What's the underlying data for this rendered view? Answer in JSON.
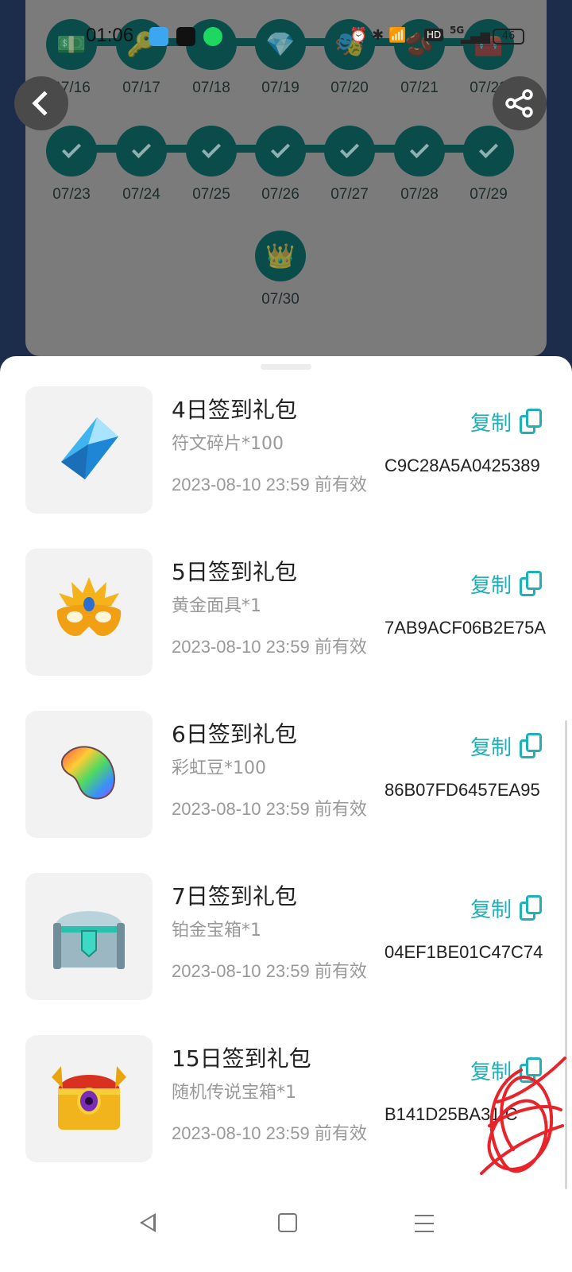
{
  "status_bar": {
    "time": "01:06",
    "network": "5G",
    "hd_badge": "HD",
    "battery": "46"
  },
  "calendar": {
    "rows": [
      [
        {
          "date": "07/16",
          "reward_icon": "cash-icon",
          "glyph": "💵",
          "checked": false
        },
        {
          "date": "07/17",
          "reward_icon": "key-icon",
          "glyph": "🔑",
          "checked": false
        },
        {
          "date": "07/18",
          "reward_icon": "blank",
          "glyph": "",
          "checked": false
        },
        {
          "date": "07/19",
          "reward_icon": "crystal-icon",
          "glyph": "💎",
          "checked": false
        },
        {
          "date": "07/20",
          "reward_icon": "mask-icon",
          "glyph": "🎭",
          "checked": false
        },
        {
          "date": "07/21",
          "reward_icon": "rainbow-bean-icon",
          "glyph": "🫘",
          "checked": false
        },
        {
          "date": "07/22",
          "reward_icon": "chest-icon",
          "glyph": "🧰",
          "checked": false
        }
      ],
      [
        {
          "date": "07/23",
          "checked": true
        },
        {
          "date": "07/24",
          "checked": true
        },
        {
          "date": "07/25",
          "checked": true
        },
        {
          "date": "07/26",
          "checked": true
        },
        {
          "date": "07/27",
          "checked": true
        },
        {
          "date": "07/28",
          "checked": true
        },
        {
          "date": "07/29",
          "checked": true
        }
      ],
      [
        {
          "date": "07/30",
          "reward_icon": "treasure-chest-icon",
          "glyph": "👑",
          "checked": false
        }
      ]
    ]
  },
  "gifts": [
    {
      "title": "4日签到礼包",
      "item": "符文碎片*100",
      "expiry": "2023-08-10 23:59 前有效",
      "copy_label": "复制",
      "code": "C9C28A5A0425389",
      "icon": "rune-crystal-icon"
    },
    {
      "title": "5日签到礼包",
      "item": "黄金面具*1",
      "expiry": "2023-08-10 23:59 前有效",
      "copy_label": "复制",
      "code": "7AB9ACF06B2E75A",
      "icon": "golden-mask-icon"
    },
    {
      "title": "6日签到礼包",
      "item": "彩虹豆*100",
      "expiry": "2023-08-10 23:59 前有效",
      "copy_label": "复制",
      "code": "86B07FD6457EA95",
      "icon": "rainbow-bean-icon"
    },
    {
      "title": "7日签到礼包",
      "item": "铂金宝箱*1",
      "expiry": "2023-08-10 23:59 前有效",
      "copy_label": "复制",
      "code": "04EF1BE01C47C74",
      "icon": "platinum-chest-icon"
    },
    {
      "title": "15日签到礼包",
      "item": "随机传说宝箱*1",
      "expiry": "2023-08-10 23:59 前有效",
      "copy_label": "复制",
      "code": "B141D25BA31   C",
      "icon": "legendary-chest-icon"
    }
  ],
  "colors": {
    "accent": "#1fb0b8",
    "calendar_node": "#0a4c4a",
    "sheet_bg": "#ffffff",
    "overlay_card": "#7b7b7b",
    "scribble": "#e8232a"
  }
}
